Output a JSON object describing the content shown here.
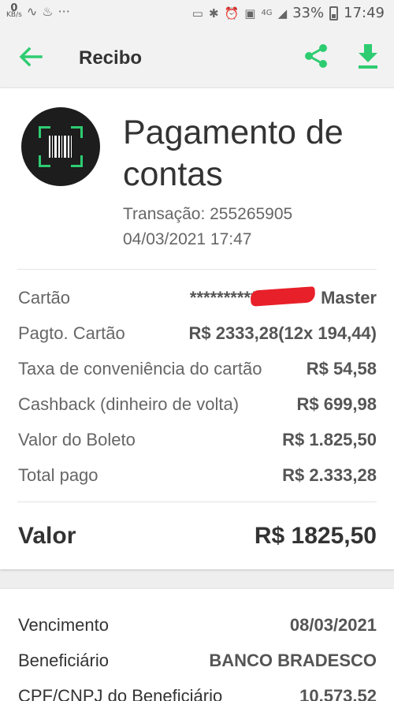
{
  "status_bar": {
    "kbs_value": "0",
    "kbs_unit": "KB/s",
    "dots": "···",
    "network": "4G",
    "battery": "33%",
    "time": "17:49"
  },
  "app_bar": {
    "title": "Recibo"
  },
  "receipt": {
    "title": "Pagamento de contas",
    "transaction": "Transação: 255265905",
    "datetime": "04/03/2021 17:47",
    "rows": [
      {
        "label": "Cartão",
        "value": "***********",
        "brand": "Master"
      },
      {
        "label": "Pagto. Cartão",
        "value": "R$ 2333,28(12x 194,44)"
      },
      {
        "label": "Taxa de conveniência do cartão",
        "value": "R$ 54,58"
      },
      {
        "label": "Cashback (dinheiro de volta)",
        "value": "R$ 699,98"
      },
      {
        "label": "Valor do Boleto",
        "value": "R$ 1.825,50"
      },
      {
        "label": "Total pago",
        "value": "R$ 2.333,28"
      }
    ],
    "total_label": "Valor",
    "total_value": "R$ 1825,50"
  },
  "details": {
    "rows": [
      {
        "label": "Vencimento",
        "value": "08/03/2021"
      },
      {
        "label": "Beneficiário",
        "value": "BANCO BRADESCO"
      },
      {
        "label": "CPF/CNPJ do Beneficiário",
        "value": "10.573.52"
      }
    ]
  },
  "colors": {
    "accent": "#2ecc71",
    "redaction": "#e8202a",
    "badge_bg": "#1d1d1d"
  }
}
